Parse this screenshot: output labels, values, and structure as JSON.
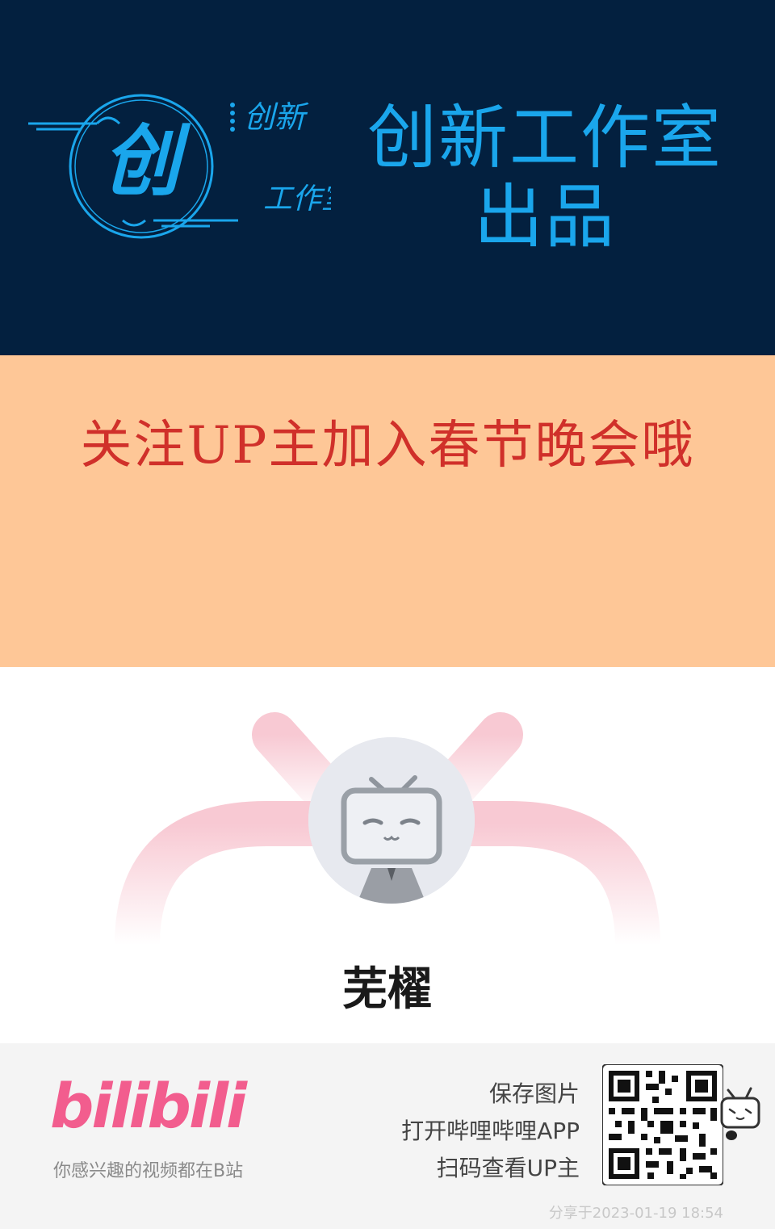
{
  "banner": {
    "logo_char": "创",
    "logo_vertical_1": "创新",
    "logo_vertical_2": "工作室",
    "title_line1": "创新工作室",
    "title_line2": "出品",
    "bg_color": "#03203f",
    "accent_color": "#1aa6ec"
  },
  "promo": {
    "text": "关注UP主加入春节晚会哦",
    "bg_color": "#fec797",
    "text_color": "#d0302a"
  },
  "profile": {
    "username": "芜櫂",
    "avatar_icon": "bilibili-tv-mascot-icon"
  },
  "footer": {
    "brand": "bilibili",
    "slogan": "你感兴趣的视频都在B站",
    "action_save": "保存图片",
    "action_open": "打开哔哩哔哩APP",
    "action_scan": "扫码查看UP主",
    "share_time": "分享于2023-01-19 18:54",
    "brand_color": "#f25d8e"
  }
}
